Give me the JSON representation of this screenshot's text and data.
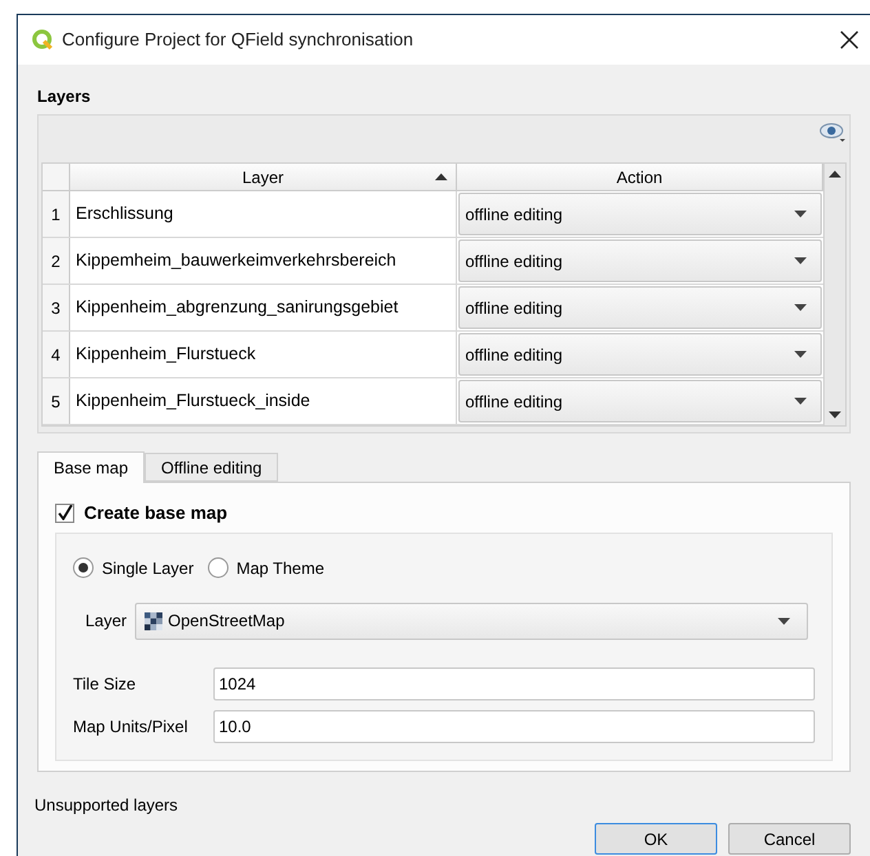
{
  "window": {
    "title": "Configure Project for QField synchronisation"
  },
  "layers": {
    "title": "Layers",
    "columns": [
      {
        "label": "Layer",
        "sorted": true
      },
      {
        "label": "Action",
        "sorted": false
      }
    ],
    "rows": [
      {
        "index": "1",
        "layer": "Erschlissung",
        "action": "offline editing"
      },
      {
        "index": "2",
        "layer": "Kippemheim_bauwerkeimverkehrsbereich",
        "action": "offline editing"
      },
      {
        "index": "3",
        "layer": "Kippenheim_abgrenzung_sanirungsgebiet",
        "action": "offline editing"
      },
      {
        "index": "4",
        "layer": "Kippenheim_Flurstueck",
        "action": "offline editing"
      },
      {
        "index": "5",
        "layer": "Kippenheim_Flurstueck_inside",
        "action": "offline editing"
      }
    ]
  },
  "tabs": [
    {
      "label": "Base map",
      "selected": true
    },
    {
      "label": "Offline editing",
      "selected": false
    }
  ],
  "base_map": {
    "create": {
      "label": "Create base map",
      "checked": true
    },
    "radios": [
      {
        "label": "Single Layer",
        "selected": true
      },
      {
        "label": "Map Theme",
        "selected": false
      }
    ],
    "layer": {
      "label": "Layer",
      "value": "OpenStreetMap"
    },
    "fields": [
      {
        "label": "Tile Size",
        "value": "1024"
      },
      {
        "label": "Map Units/Pixel",
        "value": "10.0"
      }
    ]
  },
  "unsupported": "Unsupported layers",
  "buttons": [
    {
      "label": "OK",
      "default": true
    },
    {
      "label": "Cancel",
      "default": false
    }
  ]
}
